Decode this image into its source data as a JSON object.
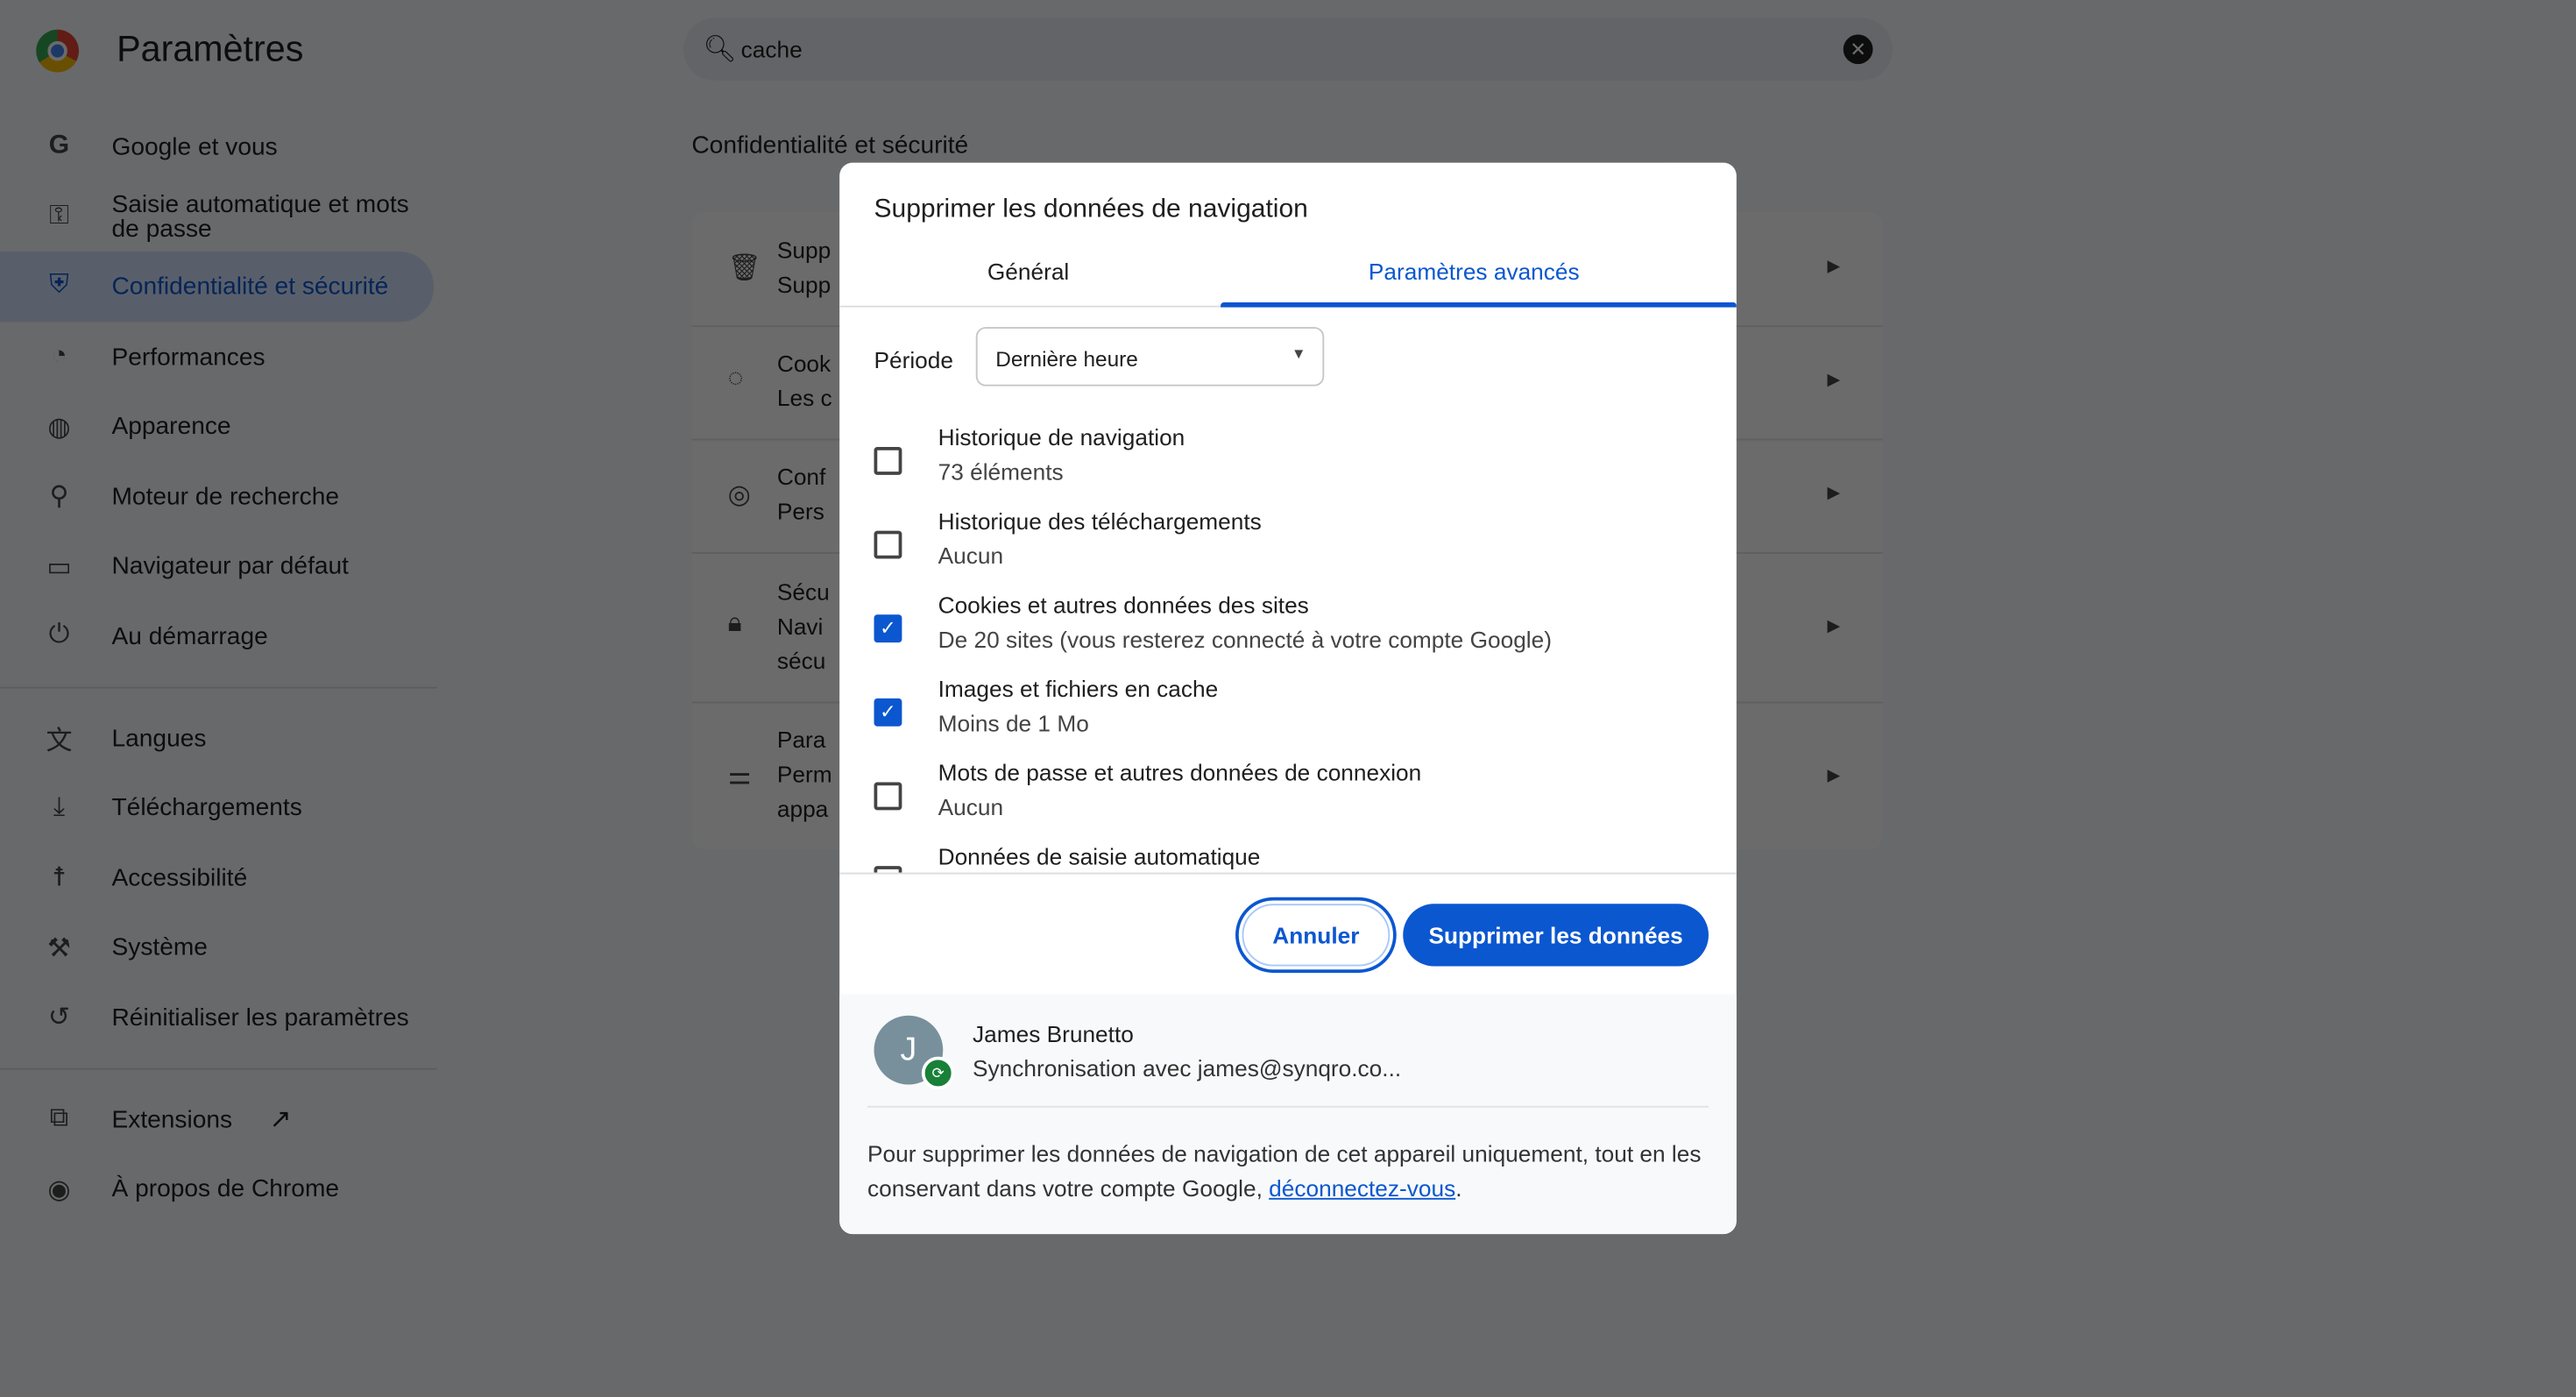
{
  "app": {
    "title": "Paramètres"
  },
  "search": {
    "value": "cache",
    "icons": {
      "search": "search-icon",
      "clear": "clear-icon"
    }
  },
  "sidebar": {
    "items": [
      {
        "label": "Google et vous",
        "icon": "google-icon"
      },
      {
        "label": "Saisie automatique et mots de passe",
        "icon": "key-icon"
      },
      {
        "label": "Confidentialité et sécurité",
        "icon": "shield-icon",
        "selected": true
      },
      {
        "label": "Performances",
        "icon": "speedometer-icon"
      },
      {
        "label": "Apparence",
        "icon": "palette-icon"
      },
      {
        "label": "Moteur de recherche",
        "icon": "search-icon"
      },
      {
        "label": "Navigateur par défaut",
        "icon": "browser-icon"
      },
      {
        "label": "Au démarrage",
        "icon": "power-icon"
      },
      {
        "label": "Langues",
        "icon": "translate-icon"
      },
      {
        "label": "Téléchargements",
        "icon": "download-icon"
      },
      {
        "label": "Accessibilité",
        "icon": "accessibility-icon"
      },
      {
        "label": "Système",
        "icon": "wrench-icon"
      },
      {
        "label": "Réinitialiser les paramètres",
        "icon": "reset-icon"
      },
      {
        "label": "Extensions",
        "icon": "extension-icon"
      },
      {
        "label": "À propos de Chrome",
        "icon": "chrome-icon"
      }
    ]
  },
  "main": {
    "section_title": "Confidentialité et sécurité",
    "rows": [
      {
        "l1": "Supp",
        "l2": "Supp"
      },
      {
        "l1": "Cook",
        "l2": "Les c"
      },
      {
        "l1": "Conf",
        "l2": "Pers"
      },
      {
        "l1": "Sécu",
        "l2": "Navi",
        "l3": "sécu"
      },
      {
        "l1": "Para",
        "l2": "Perm",
        "l3": "appa"
      }
    ]
  },
  "dialog": {
    "title": "Supprimer les données de navigation",
    "tabs": [
      {
        "label": "Général"
      },
      {
        "label": "Paramètres avancés",
        "active": true
      }
    ],
    "period": {
      "label": "Période",
      "value": "Dernière heure"
    },
    "options": [
      {
        "title": "Historique de navigation",
        "subtitle": "73 éléments",
        "checked": false
      },
      {
        "title": "Historique des téléchargements",
        "subtitle": "Aucun",
        "checked": false
      },
      {
        "title": "Cookies et autres données des sites",
        "subtitle": "De 20 sites (vous resterez connecté à votre compte Google)",
        "checked": true
      },
      {
        "title": "Images et fichiers en cache",
        "subtitle": "Moins de 1 Mo",
        "checked": true
      },
      {
        "title": "Mots de passe et autres données de connexion",
        "subtitle": "Aucun",
        "checked": false
      },
      {
        "title": "Données de saisie automatique",
        "checked": false
      }
    ],
    "cancel_label": "Annuler",
    "delete_label": "Supprimer les données",
    "account": {
      "initial": "J",
      "name": "James Brunetto",
      "sync": "Synchronisation avec james@synqro.co..."
    },
    "note_before": "Pour supprimer les données de navigation de cet appareil uniquement, tout en les conservant dans votre compte Google, ",
    "note_link": "déconnectez-vous",
    "note_after": "."
  },
  "colors": {
    "accent": "#0b57d0",
    "sync_badge": "#188038"
  }
}
